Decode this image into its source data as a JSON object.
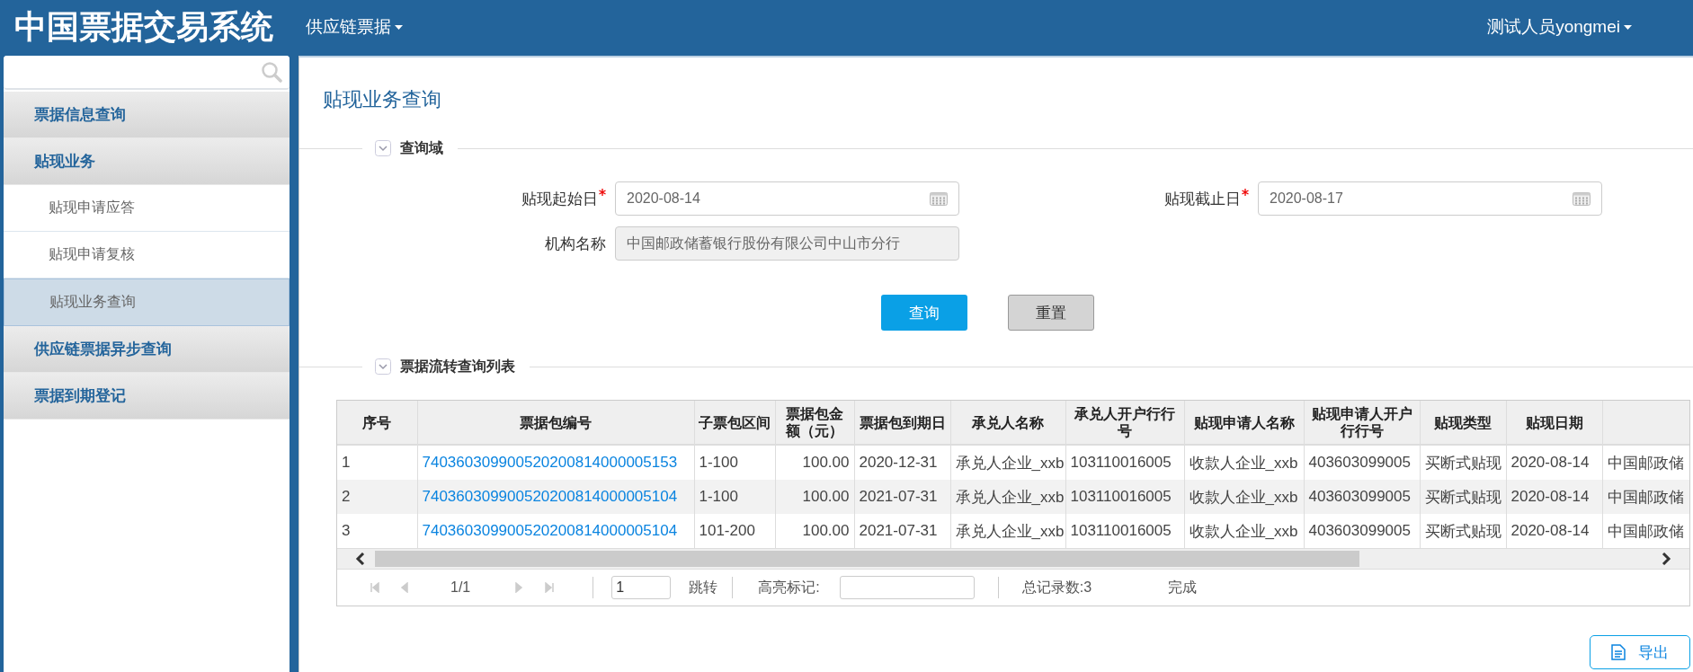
{
  "header": {
    "title": "中国票据交易系统",
    "menu": "供应链票据",
    "user": "测试人员yongmei"
  },
  "sidebar": {
    "items": [
      {
        "label": "票据信息查询",
        "selected": false
      },
      {
        "label": "贴现业务",
        "selected": false,
        "children": [
          {
            "label": "贴现申请应答",
            "selected": false
          },
          {
            "label": "贴现申请复核",
            "selected": false
          },
          {
            "label": "贴现业务查询",
            "selected": true
          }
        ]
      },
      {
        "label": "供应链票据异步查询",
        "selected": false
      },
      {
        "label": "票据到期登记",
        "selected": false
      }
    ]
  },
  "page_title": "贴现业务查询",
  "query_section": {
    "title": "查询域",
    "fields": [
      {
        "label": "贴现起始日",
        "required": true,
        "kind": "date",
        "value": "2020-08-14",
        "disabled": false
      },
      {
        "label": "贴现截止日",
        "required": true,
        "kind": "date",
        "value": "2020-08-17",
        "disabled": false
      },
      {
        "label": "机构名称",
        "required": false,
        "kind": "text",
        "value": "中国邮政储蓄银行股份有限公司中山市分行",
        "disabled": true
      }
    ],
    "buttons": [
      {
        "label": "查询",
        "kind": "primary"
      },
      {
        "label": "重置",
        "kind": "secondary"
      }
    ]
  },
  "list_section": {
    "title": "票据流转查询列表",
    "table": {
      "columns": [
        "序号",
        "票据包编号",
        "子票包区间",
        "票据包金额（元）",
        "票据包到期日",
        "承兑人名称",
        "承兑人开户行行号",
        "贴现申请人名称",
        "贴现申请人开户行行号",
        "贴现类型",
        "贴现日期"
      ],
      "rows": [
        [
          "1",
          "740360309900520200814000005153",
          "1-100",
          "100.00",
          "2020-12-31",
          "承兑人企业_xxb",
          "103110016005",
          "收款人企业_xxb",
          "403603099005",
          "买断式贴现",
          "2020-08-14",
          "中国邮政储"
        ],
        [
          "2",
          "740360309900520200814000005104",
          "1-100",
          "100.00",
          "2021-07-31",
          "承兑人企业_xxb",
          "103110016005",
          "收款人企业_xxb",
          "403603099005",
          "买断式贴现",
          "2020-08-14",
          "中国邮政储"
        ],
        [
          "3",
          "740360309900520200814000005104",
          "101-200",
          "100.00",
          "2021-07-31",
          "承兑人企业_xxb",
          "103110016005",
          "收款人企业_xxb",
          "403603099005",
          "买断式贴现",
          "2020-08-14",
          "中国邮政储"
        ]
      ]
    },
    "pager": {
      "page": "1/1",
      "page_input": "1",
      "jump": "跳转",
      "highlight_label": "高亮标记:",
      "total": "总记录数:3",
      "status": "完成"
    }
  },
  "export_button": "导出"
}
